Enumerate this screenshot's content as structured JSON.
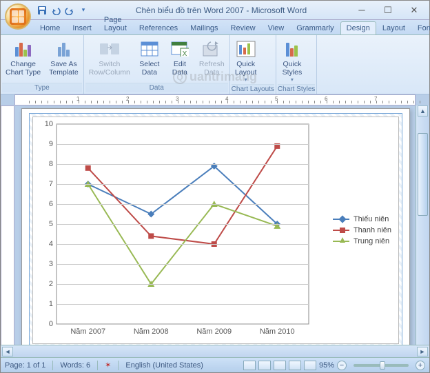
{
  "window": {
    "title": "Chèn biểu đồ trên Word 2007 - Microsoft Word"
  },
  "tabs": {
    "home": "Home",
    "insert": "Insert",
    "page_layout": "Page Layout",
    "references": "References",
    "mailings": "Mailings",
    "review": "Review",
    "view": "View",
    "grammarly": "Grammarly",
    "design": "Design",
    "layout": "Layout",
    "format": "Format"
  },
  "ribbon": {
    "type_group": "Type",
    "change_chart_type": "Change\nChart Type",
    "save_as_template": "Save As\nTemplate",
    "data_group": "Data",
    "switch_row_col": "Switch\nRow/Column",
    "select_data": "Select\nData",
    "edit_data": "Edit\nData",
    "refresh_data": "Refresh\nData",
    "chart_layouts_group": "Chart Layouts",
    "quick_layout": "Quick\nLayout",
    "chart_styles_group": "Chart Styles",
    "quick_styles": "Quick\nStyles"
  },
  "status": {
    "page": "Page: 1 of 1",
    "words": "Words: 6",
    "language": "English (United States)",
    "zoom": "95%"
  },
  "chart_data": {
    "type": "line",
    "categories": [
      "Năm 2007",
      "Năm 2008",
      "Năm 2009",
      "Năm 2010"
    ],
    "series": [
      {
        "name": "Thiếu niên",
        "color": "#4a7ebb",
        "marker": "diamond",
        "values": [
          7.0,
          5.5,
          7.9,
          5.0
        ]
      },
      {
        "name": "Thanh niên",
        "color": "#be4b48",
        "marker": "square",
        "values": [
          7.8,
          4.4,
          4.0,
          8.9
        ]
      },
      {
        "name": "Trung niên",
        "color": "#98b954",
        "marker": "triangle",
        "values": [
          7.0,
          2.0,
          6.0,
          4.9
        ]
      }
    ],
    "ylim": [
      0,
      10
    ],
    "yticks": [
      0,
      1,
      2,
      3,
      4,
      5,
      6,
      7,
      8,
      9,
      10
    ]
  },
  "watermark": "uantrimang"
}
